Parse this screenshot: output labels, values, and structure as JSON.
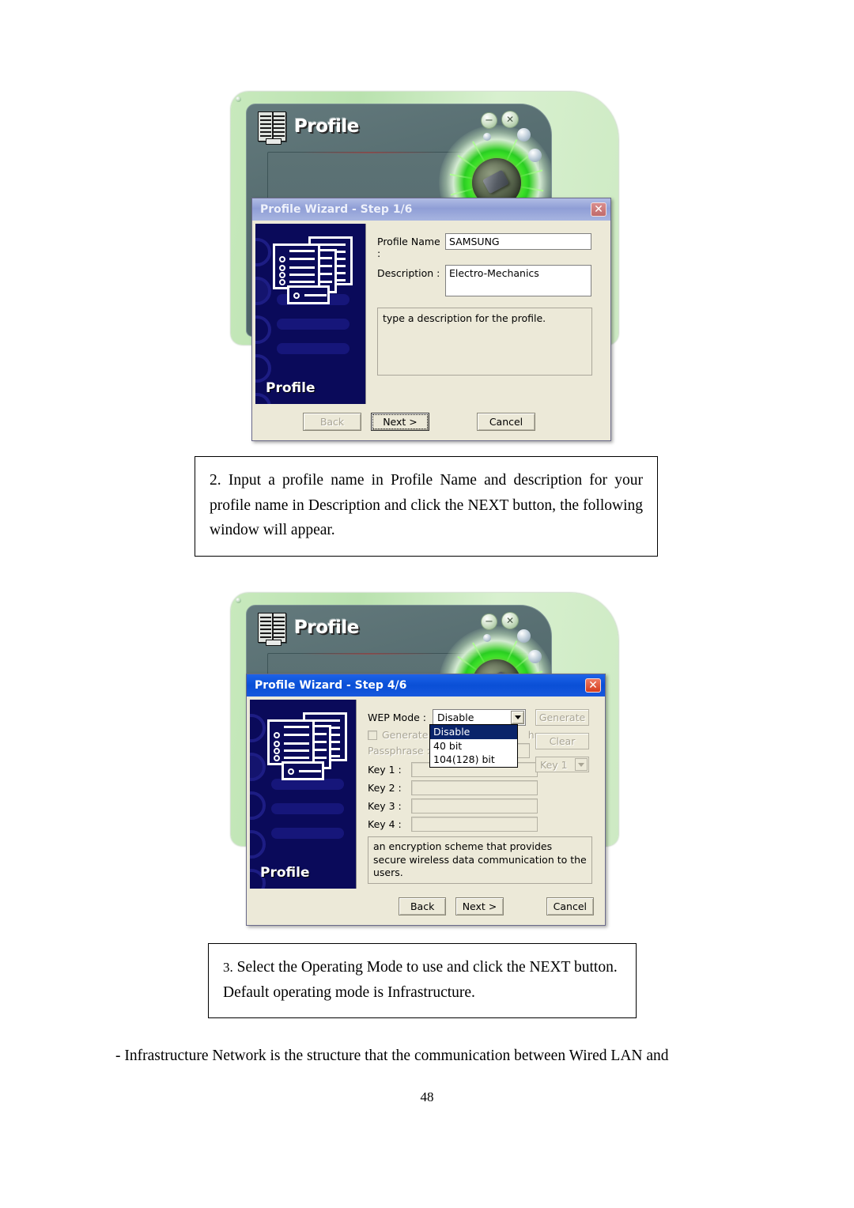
{
  "page": {
    "number": "48",
    "closing_line": "- Infrastructure Network is the structure that the communication between Wired LAN and"
  },
  "app_window": {
    "title": "Profile",
    "logo_icon": "profile-list-icon",
    "minimize_icon": "minimize-icon",
    "close_icon": "close-icon",
    "dial_icon": "usb-adapter-icon"
  },
  "wizard_step1": {
    "title": "Profile Wizard - Step 1/6",
    "close_label": "✕",
    "sidebar_label": "Profile",
    "fields": {
      "profile_name_label": "Profile Name :",
      "profile_name_value": "SAMSUNG",
      "description_label": "Description :",
      "description_value": "Electro-Mechanics"
    },
    "help_text": "type a description for the profile.",
    "buttons": {
      "back": "Back",
      "next": "Next >",
      "cancel": "Cancel"
    }
  },
  "wizard_step4": {
    "title": "Profile Wizard - Step 4/6",
    "close_label": "✕",
    "sidebar_label": "Profile",
    "wep_mode_label": "WEP Mode :",
    "wep_mode_value": "Disable",
    "wep_mode_options": [
      "Disable",
      "40 bit",
      "104(128) bit"
    ],
    "wep_mode_selected": "Disable",
    "generate_checkbox_label": "Generate W",
    "generate_checkbox_tail": "hrase",
    "passphrase_label": "Passphrase :",
    "passphrase_value": "",
    "generate_button": "Generate",
    "clear_button": "Clear",
    "key_select_value": "Key 1",
    "keys": [
      {
        "label": "Key 1 :",
        "value": ""
      },
      {
        "label": "Key 2 :",
        "value": ""
      },
      {
        "label": "Key 3 :",
        "value": ""
      },
      {
        "label": "Key 4 :",
        "value": ""
      }
    ],
    "description_text": "an encryption scheme that provides secure wireless data communication to the users.",
    "buttons": {
      "back": "Back",
      "next": "Next >",
      "cancel": "Cancel"
    }
  },
  "note_step2": {
    "text": "2. Input a profile name in Profile Name and description for your profile name in Description and click the NEXT button, the following window will appear."
  },
  "note_step3": {
    "number": "3.",
    "line1": " Select the Operating Mode to use and click the NEXT button.",
    "line2": "Default operating mode is Infrastructure."
  }
}
